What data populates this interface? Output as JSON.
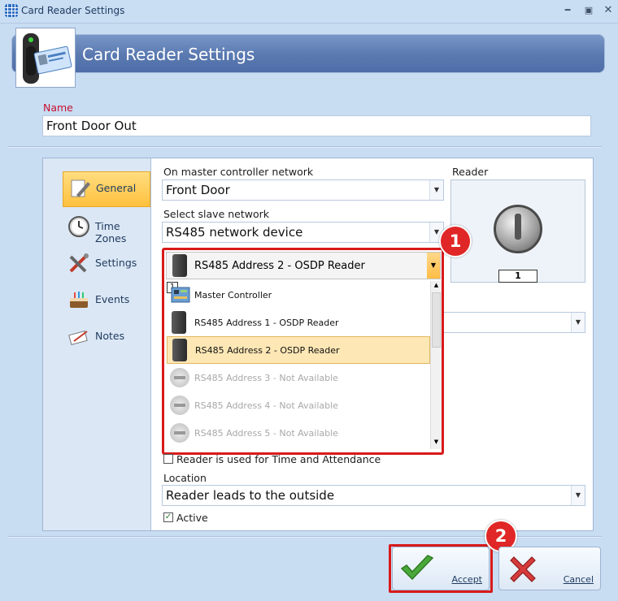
{
  "window": {
    "title": "Card Reader Settings"
  },
  "header": {
    "title": "Card Reader Settings"
  },
  "name": {
    "label": "Name",
    "value": "Front Door Out"
  },
  "nav": [
    {
      "label": "General",
      "icon": "pencil-icon",
      "selected": true
    },
    {
      "label": "Time Zones",
      "icon": "clock-icon"
    },
    {
      "label": "Settings",
      "icon": "tools-icon"
    },
    {
      "label": "Events",
      "icon": "cake-icon"
    },
    {
      "label": "Notes",
      "icon": "notes-icon"
    }
  ],
  "general": {
    "master_label": "On master controller network",
    "master_value": "Front Door",
    "slave_label": "Select slave network",
    "slave_value": "RS485 network device",
    "reader_label": "Reader",
    "reader_number": "1",
    "reader_dropdown": {
      "selected": "RS485 Address 2 - OSDP Reader",
      "row_marker": "1",
      "options": [
        {
          "label": "Master Controller",
          "state": "normal"
        },
        {
          "label": "RS485 Address 1 - OSDP Reader",
          "state": "normal"
        },
        {
          "label": "RS485 Address 2 - OSDP Reader",
          "state": "selected"
        },
        {
          "label": "RS485 Address 3 - Not Available",
          "state": "unavailable"
        },
        {
          "label": "RS485 Address 4 - Not Available",
          "state": "unavailable"
        },
        {
          "label": "RS485 Address 5 - Not Available",
          "state": "unavailable"
        }
      ]
    },
    "time_attendance_label": "Reader is used for Time and Attendance",
    "time_attendance_checked": false,
    "location_label": "Location",
    "location_value": "Reader leads to the outside",
    "active_label": "Active",
    "active_checked": true
  },
  "callouts": [
    "1",
    "2"
  ],
  "buttons": {
    "accept": "Accept",
    "cancel": "Cancel"
  },
  "colors": {
    "highlight": "#d81a1a",
    "selected": "#ffc13e",
    "header": "#5a79b0"
  }
}
